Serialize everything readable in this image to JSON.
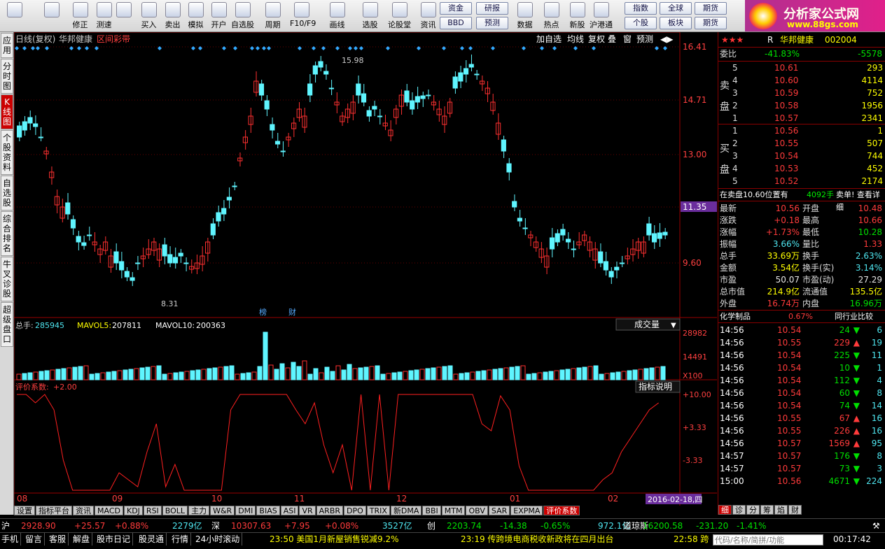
{
  "toolbar": {
    "left_buttons": [
      {
        "label": "",
        "icon": "grid-icon"
      },
      {
        "label": "",
        "icon": "back-arrow-icon"
      },
      {
        "label": "修正",
        "icon": "arrows-icon"
      },
      {
        "label": "测速",
        "icon": "speed-icon"
      },
      {
        "label": "",
        "icon": "clock-icon"
      },
      {
        "label": "买入",
        "icon": "buy-icon"
      },
      {
        "label": "卖出",
        "icon": "sell-icon"
      },
      {
        "label": "模拟",
        "icon": "hammer-icon"
      },
      {
        "label": "开户",
        "icon": "lock-icon"
      },
      {
        "label": "自选股",
        "icon": "star-icon"
      },
      {
        "label": "周期",
        "icon": "cycle-icon"
      },
      {
        "label": "F10/F9",
        "icon": "f10-icon"
      },
      {
        "label": "画线",
        "icon": "pen-icon"
      },
      {
        "label": "选股",
        "icon": "select-icon"
      },
      {
        "label": "论股堂",
        "icon": "forum-icon"
      },
      {
        "label": "资讯",
        "icon": "dpo-icon"
      },
      {
        "label": "数据",
        "icon": "pe-icon"
      },
      {
        "label": "热点",
        "icon": "hot-icon"
      },
      {
        "label": "新股",
        "icon": "ipo-icon"
      },
      {
        "label": "沪港通",
        "icon": "shhk-icon"
      }
    ],
    "small_buttons": [
      "资金",
      "研报",
      "BBD",
      "预测",
      "指数",
      "全球",
      "期货",
      "个股",
      "板块",
      "期货"
    ],
    "logo_title": "分析家公式网",
    "logo_url": "www.88gs.com"
  },
  "leftnav": [
    "应用",
    "分时图",
    "K线图",
    "个股资料",
    "自选股",
    "综合排名",
    "牛叉诊股",
    "超级盘口"
  ],
  "leftnav_active": 2,
  "chart": {
    "header_left": "日线(复权)",
    "stock_name": "华邦健康",
    "mode": "区间彩带",
    "header_buttons": [
      "加自选",
      "均线",
      "复权",
      "叠",
      "窗",
      "预测"
    ],
    "price_axis": [
      "16.41",
      "14.71",
      "13.00",
      "11.35",
      "9.60"
    ],
    "current_price_tag": "11.35",
    "high_label": "15.98",
    "low_label": "8.31",
    "event_labels": [
      "榜",
      "财"
    ],
    "vol_header": {
      "label": "总手:",
      "value": "285945",
      "ma5_label": "MAVOL5:",
      "ma5": "207811",
      "ma10_label": "MAVOL10:",
      "ma10": "200363"
    },
    "vol_dropdown": "成交量",
    "vol_axis": [
      "28982",
      "14491",
      "X100"
    ],
    "ind_header": {
      "label": "评价系数:",
      "value": "+2.00"
    },
    "ind_button": "指标说明",
    "ind_axis": [
      "+10.00",
      "+3.33",
      "-3.33"
    ],
    "months": [
      "08",
      "09",
      "10",
      "11",
      "12",
      "01",
      "02"
    ],
    "date_tag": "2016-02-18,四",
    "colors": {
      "up": "#ff3030",
      "down": "#5ff5ff",
      "ma5": "#ffffff",
      "ma10": "#ffff00",
      "indicator": "#ff2020"
    }
  },
  "bottom_tabs": [
    "设置",
    "指标平台",
    "资讯",
    "MACD",
    "KDJ",
    "RSI",
    "BOLL",
    "主力",
    "W&R",
    "DMI",
    "BIAS",
    "ASI",
    "VR",
    "ARBR",
    "DPO",
    "TRIX",
    "新DMA",
    "BBI",
    "MTM",
    "OBV",
    "SAR",
    "EXPMA",
    "评价系数"
  ],
  "right": {
    "title": "华邦健康",
    "code": "002004",
    "r_mark": "R",
    "weibi_label": "委比",
    "weibi_value": "-41.83%",
    "weicha_value": "-5578",
    "sell_label": "卖盘",
    "buy_label": "买盘",
    "sells": [
      {
        "lv": "5",
        "price": "10.61",
        "vol": "293"
      },
      {
        "lv": "4",
        "price": "10.60",
        "vol": "4114"
      },
      {
        "lv": "3",
        "price": "10.59",
        "vol": "752"
      },
      {
        "lv": "2",
        "price": "10.58",
        "vol": "1956"
      },
      {
        "lv": "1",
        "price": "10.57",
        "vol": "2341"
      }
    ],
    "buys": [
      {
        "lv": "1",
        "price": "10.56",
        "vol": "1"
      },
      {
        "lv": "2",
        "price": "10.55",
        "vol": "507"
      },
      {
        "lv": "3",
        "price": "10.54",
        "vol": "744"
      },
      {
        "lv": "4",
        "price": "10.53",
        "vol": "452"
      },
      {
        "lv": "5",
        "price": "10.52",
        "vol": "2174"
      }
    ],
    "notice": "在卖盘10.60位置有",
    "notice_vol": "4092手",
    "notice_tail": "卖单! 查看详细",
    "stats": [
      {
        "l1": "最新",
        "v1": "10.56",
        "c1": "red",
        "l2": "开盘",
        "v2": "10.48",
        "c2": "red"
      },
      {
        "l1": "涨跌",
        "v1": "+0.18",
        "c1": "red",
        "l2": "最高",
        "v2": "10.66",
        "c2": "red"
      },
      {
        "l1": "涨幅",
        "v1": "+1.73%",
        "c1": "red",
        "l2": "最低",
        "v2": "10.28",
        "c2": "grn"
      },
      {
        "l1": "振幅",
        "v1": "3.66%",
        "c1": "cyn",
        "l2": "量比",
        "v2": "1.33",
        "c2": "red"
      },
      {
        "l1": "总手",
        "v1": "33.69万",
        "c1": "yel",
        "l2": "换手",
        "v2": "2.63%",
        "c2": "cyn"
      },
      {
        "l1": "金额",
        "v1": "3.54亿",
        "c1": "yel",
        "l2": "换手(实)",
        "v2": "3.14%",
        "c2": "cyn"
      },
      {
        "l1": "市盈",
        "v1": "50.07",
        "c1": "wht",
        "l2": "市盈(动)",
        "v2": "27.29",
        "c2": "wht"
      },
      {
        "l1": "总市值",
        "v1": "214.9亿",
        "c1": "yel",
        "l2": "流通值",
        "v2": "135.5亿",
        "c2": "yel"
      },
      {
        "l1": "外盘",
        "v1": "16.74万",
        "c1": "red",
        "l2": "内盘",
        "v2": "16.96万",
        "c2": "grn"
      }
    ],
    "industry": "化学制品",
    "industry_pct": "0.67%",
    "industry_button": "同行业比较",
    "ticks": [
      {
        "t": "14:56",
        "p": "10.54",
        "v": "24",
        "d": "down",
        "n": "6"
      },
      {
        "t": "14:56",
        "p": "10.55",
        "v": "229",
        "d": "up",
        "n": "19"
      },
      {
        "t": "14:56",
        "p": "10.54",
        "v": "225",
        "d": "down",
        "n": "11"
      },
      {
        "t": "14:56",
        "p": "10.54",
        "v": "10",
        "d": "down",
        "n": "1"
      },
      {
        "t": "14:56",
        "p": "10.54",
        "v": "112",
        "d": "down",
        "n": "4"
      },
      {
        "t": "14:56",
        "p": "10.54",
        "v": "60",
        "d": "down",
        "n": "8"
      },
      {
        "t": "14:56",
        "p": "10.54",
        "v": "74",
        "d": "down",
        "n": "14"
      },
      {
        "t": "14:56",
        "p": "10.55",
        "v": "67",
        "d": "up",
        "n": "16"
      },
      {
        "t": "14:56",
        "p": "10.55",
        "v": "226",
        "d": "up",
        "n": "16"
      },
      {
        "t": "14:56",
        "p": "10.57",
        "v": "1569",
        "d": "up",
        "n": "95"
      },
      {
        "t": "14:57",
        "p": "10.57",
        "v": "176",
        "d": "down",
        "n": "8"
      },
      {
        "t": "14:57",
        "p": "10.57",
        "v": "73",
        "d": "down",
        "n": "3"
      },
      {
        "t": "15:00",
        "p": "10.56",
        "v": "4671",
        "d": "down",
        "n": "224"
      }
    ],
    "tabs": [
      "细",
      "诊",
      "分",
      "筹",
      "焰",
      "财"
    ]
  },
  "index_bar": [
    {
      "name": "沪",
      "val": "2928.90",
      "chg": "+25.57",
      "pct": "+0.88%",
      "amt": "2279亿"
    },
    {
      "name": "深",
      "val": "10307.63",
      "chg": "+7.95",
      "pct": "+0.08%",
      "amt": "3527亿"
    },
    {
      "name": "创",
      "val": "2203.74",
      "chg": "-14.38",
      "pct": "-0.65%",
      "amt": "972.1亿"
    },
    {
      "name": "道琼斯",
      "val": "16200.58",
      "chg": "-231.20",
      "pct": "-1.41%",
      "amt": ""
    }
  ],
  "status": {
    "items": [
      "手机",
      "留言",
      "客服",
      "解盘",
      "股市日记",
      "股灵通",
      "行情",
      "24小时滚动"
    ],
    "news1_time": "23:50",
    "news1": "美国1月新屋销售锐减9.2%",
    "news2_time": "23:19",
    "news2": "传跨境电商税收新政将在四月出台",
    "news3_time": "22:58",
    "news3": "跨",
    "search_placeholder": "代码/名称/简拼/功能",
    "clock": "00:17:42"
  }
}
